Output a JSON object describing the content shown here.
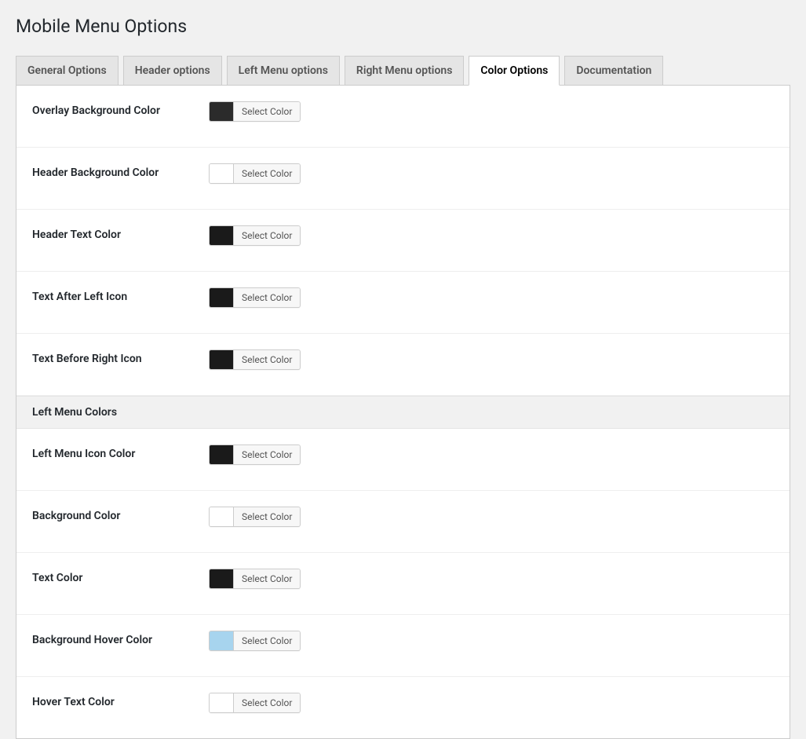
{
  "page": {
    "title": "Mobile Menu Options"
  },
  "tabs": [
    {
      "label": "General Options",
      "active": false
    },
    {
      "label": "Header options",
      "active": false
    },
    {
      "label": "Left Menu options",
      "active": false
    },
    {
      "label": "Right Menu options",
      "active": false
    },
    {
      "label": "Color Options",
      "active": true
    },
    {
      "label": "Documentation",
      "active": false
    }
  ],
  "select_color_label": "Select Color",
  "sections": [
    {
      "heading": null,
      "fields": [
        {
          "id": "overlay-bg-color",
          "label": "Overlay Background Color",
          "color": "#2b2b2b"
        },
        {
          "id": "header-bg-color",
          "label": "Header Background Color",
          "color": "#ffffff"
        },
        {
          "id": "header-text-color",
          "label": "Header Text Color",
          "color": "#1a1a1a"
        },
        {
          "id": "text-after-left-icon",
          "label": "Text After Left Icon",
          "color": "#1a1a1a"
        },
        {
          "id": "text-before-right-icon",
          "label": "Text Before Right Icon",
          "color": "#1a1a1a"
        }
      ]
    },
    {
      "heading": "Left Menu Colors",
      "fields": [
        {
          "id": "left-menu-icon-color",
          "label": "Left Menu Icon Color",
          "color": "#1a1a1a"
        },
        {
          "id": "left-menu-bg-color",
          "label": "Background Color",
          "color": "#ffffff"
        },
        {
          "id": "left-menu-text-color",
          "label": "Text Color",
          "color": "#1a1a1a"
        },
        {
          "id": "left-menu-bg-hover-color",
          "label": "Background Hover Color",
          "color": "#a7d4ee"
        },
        {
          "id": "left-menu-hover-text-color",
          "label": "Hover Text Color",
          "color": "#ffffff"
        }
      ]
    }
  ]
}
